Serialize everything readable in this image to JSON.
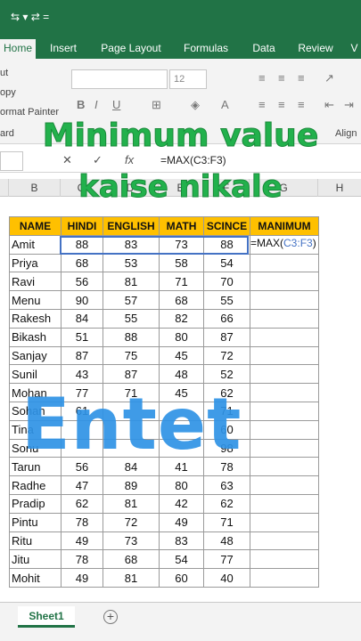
{
  "titlebar": {
    "qat": "⇆  ▾ ⇄ ="
  },
  "tabs": [
    {
      "label": "Home",
      "active": true
    },
    {
      "label": "Insert"
    },
    {
      "label": "Page Layout"
    },
    {
      "label": "Formulas"
    },
    {
      "label": "Data"
    },
    {
      "label": "Review"
    },
    {
      "label": "V"
    }
  ],
  "ribbon": {
    "cut": "ut",
    "copy": "opy",
    "format_painter": "ormat Painter",
    "clipboard": "ard",
    "font_size": "12",
    "alignment": "Align"
  },
  "overlay": {
    "line1": "Minimum value",
    "line2": "kaise nikale",
    "big": "Entet"
  },
  "formula_bar": {
    "fx": "fx",
    "text": "=MAX(C3:F3)"
  },
  "column_headers": [
    "B",
    "C",
    "D",
    "E",
    "F",
    "G",
    "H"
  ],
  "table": {
    "headers": [
      "NAME",
      "HINDI",
      "ENGLISH",
      "MATH",
      "SCINCE",
      "MANIMUM"
    ],
    "rows": [
      [
        "Amit",
        "88",
        "83",
        "73",
        "88"
      ],
      [
        "Priya",
        "68",
        "53",
        "58",
        "54"
      ],
      [
        "Ravi",
        "56",
        "81",
        "71",
        "70"
      ],
      [
        "Menu",
        "90",
        "57",
        "68",
        "55"
      ],
      [
        "Rakesh",
        "84",
        "55",
        "82",
        "66"
      ],
      [
        "Bikash",
        "51",
        "88",
        "80",
        "87"
      ],
      [
        "Sanjay",
        "87",
        "75",
        "45",
        "72"
      ],
      [
        "Sunil",
        "43",
        "87",
        "48",
        "52"
      ],
      [
        "Mohan",
        "77",
        "71",
        "45",
        "62"
      ],
      [
        "Sohan",
        "61",
        "",
        "",
        "71"
      ],
      [
        "Tina",
        "",
        "",
        "",
        "60"
      ],
      [
        "Sonu",
        "",
        "",
        "",
        "98"
      ],
      [
        "Tarun",
        "56",
        "84",
        "41",
        "78"
      ],
      [
        "Radhe",
        "47",
        "89",
        "80",
        "63"
      ],
      [
        "Pradip",
        "62",
        "81",
        "42",
        "62"
      ],
      [
        "Pintu",
        "78",
        "72",
        "49",
        "71"
      ],
      [
        "Ritu",
        "49",
        "73",
        "83",
        "48"
      ],
      [
        "Jitu",
        "78",
        "68",
        "54",
        "77"
      ],
      [
        "Mohit",
        "49",
        "81",
        "60",
        "40"
      ]
    ]
  },
  "editing_cell": {
    "prefix": "=MAX(",
    "ref": "C3:F3",
    "suffix": ")"
  },
  "sheet": {
    "tab": "Sheet1",
    "add": "+"
  }
}
